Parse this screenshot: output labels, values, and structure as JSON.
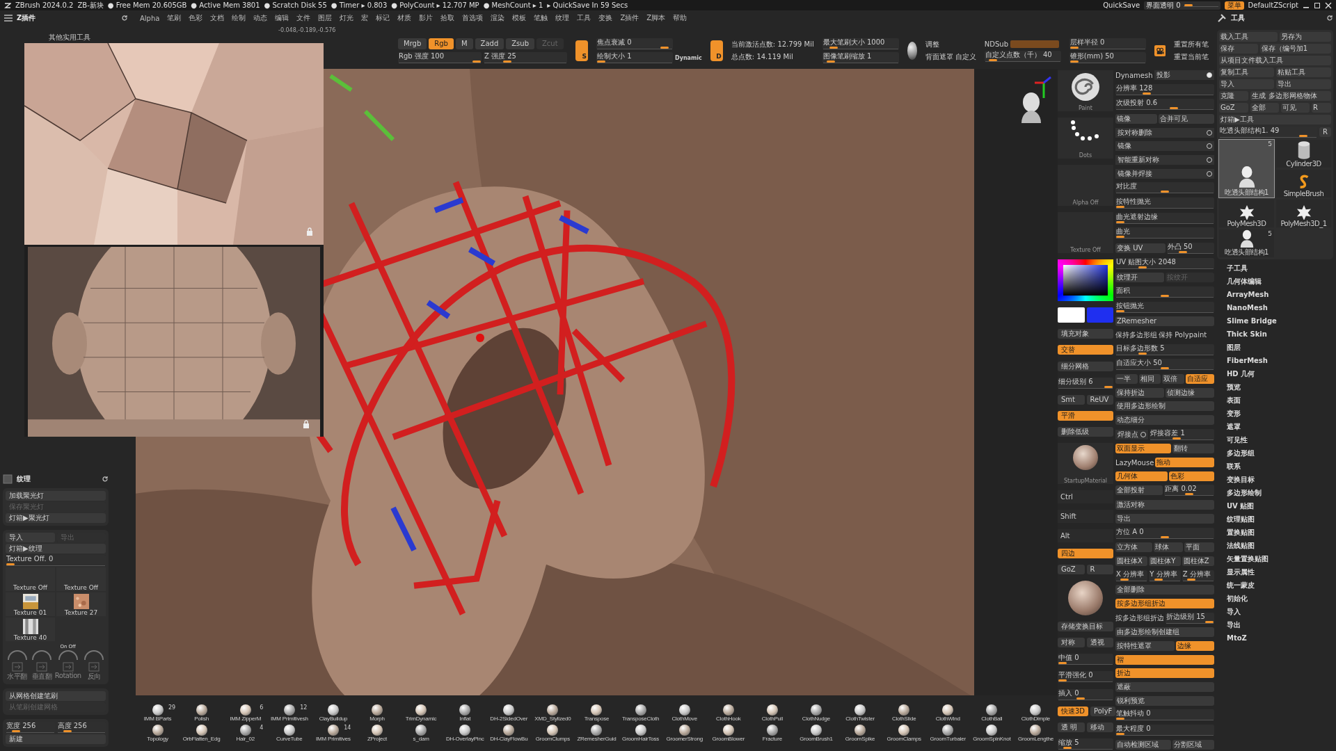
{
  "status_bar": {
    "items": [
      "ZBrush 2024.0.2",
      "ZB-新块",
      "● Free Mem 20.605GB",
      "● Active Mem 3801",
      "● Scratch Disk 55",
      "● Timer ▸ 0.803",
      "● PolyCount ▸ 12.707 MP",
      "● MeshCount ▸ 1",
      "▸ QuickSave In 59 Secs"
    ],
    "quicksave": "QuickSave",
    "opacity": {
      "label": "界面透明 0",
      "level": 0.05
    },
    "menu_button": {
      "label": "菜单",
      "on": true
    },
    "script": "DefaultZScript"
  },
  "menu": {
    "panel_title": "Z插件",
    "items": [
      "Alpha",
      "笔刷",
      "色彩",
      "文档",
      "绘制",
      "动态",
      "编辑",
      "文件",
      "图层",
      "灯光",
      "宏",
      "标记",
      "材质",
      "影片",
      "拾取",
      "首选项",
      "渲染",
      "模板",
      "笔触",
      "纹理",
      "工具",
      "变换",
      "Z插件",
      "Z脚本",
      "帮助"
    ]
  },
  "coords": "-0.048,-0.189,-0.576",
  "subpalette": "其他实用工具",
  "toolbar": {
    "modes": [
      {
        "label": "Mrgb",
        "on": false
      },
      {
        "label": "Rgb",
        "on": true
      },
      {
        "label": "M",
        "on": false
      }
    ],
    "zmodes": [
      {
        "label": "Zadd",
        "on": false,
        "disabled": false
      },
      {
        "label": "Zsub",
        "on": false,
        "disabled": false
      },
      {
        "label": "Zcut",
        "disabled": true
      }
    ],
    "intensity": [
      {
        "label": "Rgb 强度 100",
        "level": 1
      },
      {
        "label": "Z 强度 25",
        "level": 0.25
      }
    ],
    "stroke_badge": "S",
    "focal": [
      {
        "label": "焦点衰减 0",
        "level": 0.95
      },
      {
        "label": "绘制大小 1",
        "level": 0.0
      }
    ],
    "dynamic": "Dynamic",
    "dots_badge": "D",
    "stats": [
      "当前激活点数: 12.799 Mil",
      "总点数: 14.119 Mil"
    ],
    "brush_size": [
      {
        "label": "最大笔刷大小 1000",
        "level": 0.1
      },
      {
        "label": "图像笔刷缩放 1",
        "level": 0.05
      }
    ],
    "material": [
      "调整",
      "背面遮罩",
      "自定义"
    ],
    "ndsub": "NDSub",
    "ndsub_slider": {
      "label": "自定义点数（千） 40",
      "level": 0.05
    },
    "radius": [
      {
        "label": "层样半径 0",
        "level": 0
      },
      {
        "label": "锥形(mm) 50",
        "level": 0
      }
    ],
    "reset": [
      "重置所有笔",
      "重置当前笔"
    ]
  },
  "texture_panel": {
    "title": "纹理",
    "spot": [
      {
        "label": "加载聚光灯",
        "disabled": false
      },
      {
        "label": "保存聚光灯",
        "disabled": true
      },
      {
        "label": "灯箱▶聚光灯",
        "disabled": false
      }
    ],
    "io": [
      {
        "label": "导入",
        "disabled": false
      },
      {
        "label": "导出",
        "disabled": true
      }
    ],
    "lightbox": "灯箱▶纹理",
    "slider": {
      "label": "Texture Off. 0",
      "level": 0
    },
    "textures": [
      {
        "label": "Texture Off",
        "kind": "empty"
      },
      {
        "label": "Texture Off",
        "kind": "empty"
      },
      {
        "label": "Texture 01",
        "kind": "room"
      },
      {
        "label": "Texture 27",
        "kind": "noise"
      },
      {
        "label": "Texture 40",
        "kind": "bars"
      }
    ],
    "onoff": "On Off",
    "flip": [
      "水平翻",
      "垂直翻",
      "Rotation",
      "反向"
    ],
    "brush": [
      {
        "label": "从网格创建笔刷",
        "disabled": false
      },
      {
        "label": "从笔刷创建网格",
        "disabled": true
      }
    ],
    "size": [
      {
        "label": "宽度 256",
        "level": 0.15
      },
      {
        "label": "高度 256",
        "level": 0.15
      }
    ],
    "new": "新建"
  },
  "strip": [
    {
      "kind": "thumb",
      "label": "Paint"
    },
    {
      "kind": "thumb",
      "label": "Dots"
    },
    {
      "kind": "thumb",
      "label": "Alpha Off"
    },
    {
      "kind": "thumb",
      "label": "Texture Off"
    },
    {
      "kind": "picker"
    },
    {
      "kind": "swatches"
    },
    {
      "kind": "button",
      "label": "填充对象",
      "on": false
    },
    {
      "kind": "button",
      "label": "交替",
      "on": true
    },
    {
      "kind": "button",
      "label": "细分网格",
      "on": false
    },
    {
      "kind": "slider",
      "label": "细分级别 6",
      "level": 1
    },
    {
      "kind": "pair",
      "labels": [
        "Smt",
        "ReUV"
      ]
    },
    {
      "kind": "button",
      "label": "平滑",
      "on": true
    },
    {
      "kind": "button",
      "label": "删除低级",
      "on": false
    },
    {
      "kind": "material",
      "label": "StartupMaterial"
    },
    {
      "kind": "key",
      "label": "Ctrl"
    },
    {
      "kind": "key",
      "label": "Shift"
    },
    {
      "kind": "key",
      "label": "Alt"
    },
    {
      "kind": "button",
      "label": "四边",
      "on": true
    },
    {
      "kind": "pair",
      "labels": [
        "GoZ",
        "R"
      ]
    },
    {
      "kind": "gizmo"
    },
    {
      "kind": "button",
      "label": "存储变换目标",
      "on": false
    },
    {
      "kind": "pair",
      "labels": [
        "对称",
        "透视"
      ]
    },
    {
      "kind": "slider",
      "label": "中值 0",
      "level": 0
    },
    {
      "kind": "slider",
      "label": "平滑强化 0",
      "level": 0
    },
    {
      "kind": "slider",
      "label": "插入 0",
      "level": 0.4
    },
    {
      "kind": "pair",
      "labels": [
        "快速3D",
        "PolyF"
      ],
      "on": true
    },
    {
      "kind": "pair",
      "labels": [
        "透 明",
        "移动"
      ],
      "on": false
    },
    {
      "kind": "slider",
      "label": "缩放 5",
      "level": 0.1
    }
  ],
  "settings": [
    [
      {
        "kind": "text",
        "label": "Dynamesh"
      },
      {
        "kind": "check",
        "label": "投影",
        "on": true
      }
    ],
    [
      {
        "kind": "slider",
        "label": "分辨率 128",
        "level": 0.3
      }
    ],
    [
      {
        "kind": "slider",
        "label": "次级投射 0.6",
        "level": 0.6
      }
    ],
    [
      {
        "kind": "button",
        "label": "镜像",
        "on": false
      },
      {
        "kind": "button",
        "label": "合并可见",
        "on": false
      }
    ],
    [
      {
        "kind": "check",
        "label": "按对称删除",
        "on": false
      }
    ],
    [
      {
        "kind": "check",
        "label": "镜像",
        "on": false
      }
    ],
    [
      {
        "kind": "check",
        "label": "智能重新对称",
        "on": false
      }
    ],
    [
      {
        "kind": "check",
        "label": "镜像并焊接",
        "on": false
      }
    ],
    [
      {
        "kind": "slider",
        "label": "对比度",
        "level": 0.5
      }
    ],
    [
      {
        "kind": "slider",
        "label": "按特性抛光",
        "level": 0
      }
    ],
    [
      {
        "kind": "slider",
        "label": "曲光遮射边缘",
        "level": 0
      }
    ],
    [
      {
        "kind": "slider",
        "label": "曲光",
        "level": 0
      }
    ],
    [
      {
        "kind": "button",
        "label": "变换 UV",
        "on": false
      },
      {
        "kind": "slider",
        "label": "外凸 50",
        "level": 0.3
      }
    ],
    [
      {
        "kind": "slider",
        "label": "UV 贴图大小 2048",
        "level": 0.25
      }
    ],
    [
      {
        "kind": "button",
        "label": "纹理开",
        "on": false
      },
      {
        "kind": "button",
        "label": "按纹开",
        "disabled": true
      }
    ],
    [
      {
        "kind": "slider",
        "label": "面积",
        "level": 0.5
      }
    ],
    [
      {
        "kind": "slider",
        "label": "按钮抛光",
        "level": 0
      }
    ],
    [
      {
        "kind": "button",
        "label": "ZRemesher",
        "on": false
      }
    ],
    [
      {
        "kind": "text",
        "label": "保持多边形组"
      },
      {
        "kind": "text",
        "label": "保持 Polypaint"
      }
    ],
    [
      {
        "kind": "slider",
        "label": "目标多边形数 5",
        "level": 0.25
      }
    ],
    [
      {
        "kind": "slider",
        "label": "自适应大小 50",
        "level": 0.5
      }
    ],
    [
      {
        "kind": "button",
        "label": "一半",
        "on": false
      },
      {
        "kind": "button",
        "label": "相同",
        "on": false
      },
      {
        "kind": "button",
        "label": "双倍",
        "on": false
      },
      {
        "kind": "button",
        "label": "自适应",
        "on": true
      }
    ],
    [
      {
        "kind": "button",
        "label": "保持折边",
        "on": false
      },
      {
        "kind": "button",
        "label": "侦测边缘",
        "on": false
      }
    ],
    [
      {
        "kind": "button",
        "label": "使用多边形绘制",
        "on": false
      }
    ],
    [
      {
        "kind": "button",
        "label": "动态细分",
        "on": false
      }
    ],
    [
      {
        "kind": "check",
        "label": "焊接点",
        "on": false
      },
      {
        "kind": "slider",
        "label": "焊接容差 1",
        "level": 0.4
      }
    ],
    [
      {
        "kind": "button",
        "label": "双面显示",
        "on": true
      },
      {
        "kind": "button",
        "label": "翻转",
        "on": false
      }
    ],
    [
      {
        "kind": "text",
        "label": "LazyMouse"
      },
      {
        "kind": "button",
        "label": "拖动",
        "on": true
      }
    ],
    [
      {
        "kind": "button",
        "label": "几何体",
        "on": true
      },
      {
        "kind": "button",
        "label": "色彩",
        "on": true
      }
    ],
    [
      {
        "kind": "button",
        "label": "全部投射",
        "on": false
      },
      {
        "kind": "slider",
        "label": "距离 0.02",
        "level": 0.5
      }
    ],
    [
      {
        "kind": "button",
        "label": "激活对称",
        "on": false
      }
    ],
    [
      {
        "kind": "button",
        "label": "导出",
        "on": false
      }
    ],
    [
      {
        "kind": "slider",
        "label": "方位 A 0",
        "level": 0.5
      }
    ],
    [
      {
        "kind": "button",
        "label": "立方体",
        "on": false
      },
      {
        "kind": "button",
        "label": "球体",
        "on": false
      },
      {
        "kind": "button",
        "label": "平面",
        "on": false
      }
    ],
    [
      {
        "kind": "button",
        "label": "圆柱体X",
        "on": false
      },
      {
        "kind": "button",
        "label": "圆柱体Y",
        "on": false
      },
      {
        "kind": "button",
        "label": "圆柱体Z",
        "on": false
      }
    ],
    [
      {
        "kind": "slider",
        "label": "X 分辨率",
        "level": 0.2
      },
      {
        "kind": "slider",
        "label": "Y 分辨率",
        "level": 0.2
      },
      {
        "kind": "slider",
        "label": "Z 分辨率",
        "level": 0.2
      }
    ],
    [
      {
        "kind": "button",
        "label": "全部删除",
        "on": false
      }
    ],
    [
      {
        "kind": "button",
        "label": "按多边形组折边",
        "on": true
      }
    ],
    [
      {
        "kind": "text",
        "label": "按多边形组折边"
      },
      {
        "kind": "slider",
        "label": "折边级别 15",
        "level": 1
      }
    ],
    [
      {
        "kind": "button",
        "label": "由多边形绘制创建组",
        "on": false
      }
    ],
    [
      {
        "kind": "button",
        "label": "按特性遮罩",
        "on": false
      },
      {
        "kind": "button",
        "label": "边缘",
        "on": true
      }
    ],
    [
      {
        "kind": "button",
        "label": "褶",
        "on": true
      }
    ],
    [
      {
        "kind": "button",
        "label": "折边",
        "on": true
      }
    ],
    [
      {
        "kind": "button",
        "label": "遮蔽",
        "on": false
      }
    ],
    [
      {
        "kind": "button",
        "label": "锐利预览",
        "on": false
      }
    ],
    [
      {
        "kind": "slider",
        "label": "笔触抖动 0",
        "level": 0
      }
    ],
    [
      {
        "kind": "slider",
        "label": "最大程度 0",
        "level": 0
      }
    ],
    [
      {
        "kind": "button",
        "label": "自动检测区域",
        "on": false
      },
      {
        "kind": "button",
        "label": "分割区域",
        "on": false
      }
    ]
  ],
  "tool_panel": {
    "title": "工具",
    "buttons": [
      [
        "载入工具",
        "另存为"
      ],
      [
        "保存",
        "保存（编号加1"
      ],
      [
        "从项目文件载入工具"
      ],
      [
        "复制工具",
        "粘贴工具"
      ],
      [
        "导入",
        "导出"
      ],
      [
        "克隆",
        "生成 多边形网格物体"
      ],
      [
        "GoZ",
        "全部",
        "可见",
        "R"
      ],
      [
        "灯箱▶工具"
      ]
    ],
    "slider": {
      "label": "吃透头部结构1. 49",
      "level": 0.9
    },
    "slider_r": "R",
    "tools": [
      {
        "label": "吃透头部结构1",
        "count": "5",
        "selected": true
      },
      {
        "label": "Cylinder3D",
        "selected": false
      },
      {
        "label": "SimpleBrush",
        "selected": false
      },
      {
        "label": "PolyMesh3D",
        "selected": false
      },
      {
        "label": "PolyMesh3D_1",
        "selected": false
      },
      {
        "label": "吃透头部结构1",
        "count": "5",
        "selected": false
      }
    ],
    "list": [
      "子工具",
      "几何体编辑",
      "ArrayMesh",
      "NanoMesh",
      "Slime Bridge",
      "Thick Skin",
      "图层",
      "FiberMesh",
      "HD 几何",
      "预览",
      "表面",
      "变形",
      "遮罩",
      "可见性",
      "多边形组",
      "联系",
      "变换目标",
      "多边形绘制",
      "UV 贴图",
      "纹理贴图",
      "置换贴图",
      "法线贴图",
      "矢量置换贴图",
      "显示属性",
      "统一蒙皮",
      "初始化",
      "导入",
      "导出",
      "MtoZ"
    ]
  },
  "brushes": [
    [
      {
        "label": "IMM BParts",
        "count": "29"
      },
      {
        "label": "Polish"
      },
      {
        "label": "IMM ZipperM",
        "count": "6"
      },
      {
        "label": "IMM Primitivesh",
        "count": "12"
      },
      {
        "label": "ClayBuildup"
      },
      {
        "label": "Morph"
      },
      {
        "label": "TrimDynamic"
      },
      {
        "label": "Inflat"
      },
      {
        "label": "DH-2SidedOver"
      },
      {
        "label": "XMD_Stylized0"
      },
      {
        "label": "Transpose"
      },
      {
        "label": "TransposeCloth"
      },
      {
        "label": "ClothMove"
      },
      {
        "label": "ClothHook"
      },
      {
        "label": "ClothPull"
      },
      {
        "label": "ClothNudge"
      },
      {
        "label": "ClothTwister"
      },
      {
        "label": "ClothSlide"
      },
      {
        "label": "ClothWind"
      },
      {
        "label": "ClothBall"
      },
      {
        "label": "ClothDimple"
      }
    ],
    [
      {
        "label": "Topology"
      },
      {
        "label": "OrbFlatten_Edg"
      },
      {
        "label": "Hair_02",
        "count": "4"
      },
      {
        "label": "CurveTube"
      },
      {
        "label": "IMM Primitives",
        "count": "14"
      },
      {
        "label": "ZProject"
      },
      {
        "label": "s_dam"
      },
      {
        "label": "DH-OverlayPinc"
      },
      {
        "label": "DH-ClayFlowBu"
      },
      {
        "label": "GroomClumps"
      },
      {
        "label": "ZRemesherGuid"
      },
      {
        "label": "GroomHairToss"
      },
      {
        "label": "GroomerStrong"
      },
      {
        "label": "GroomBlower"
      },
      {
        "label": "Fracture"
      },
      {
        "label": "GroomBrush1"
      },
      {
        "label": "GroomSpike"
      },
      {
        "label": "GroomClamps"
      },
      {
        "label": "GroomTurbaler"
      },
      {
        "label": "GroomSpinKnot"
      },
      {
        "label": "GroomLengthe"
      }
    ]
  ]
}
